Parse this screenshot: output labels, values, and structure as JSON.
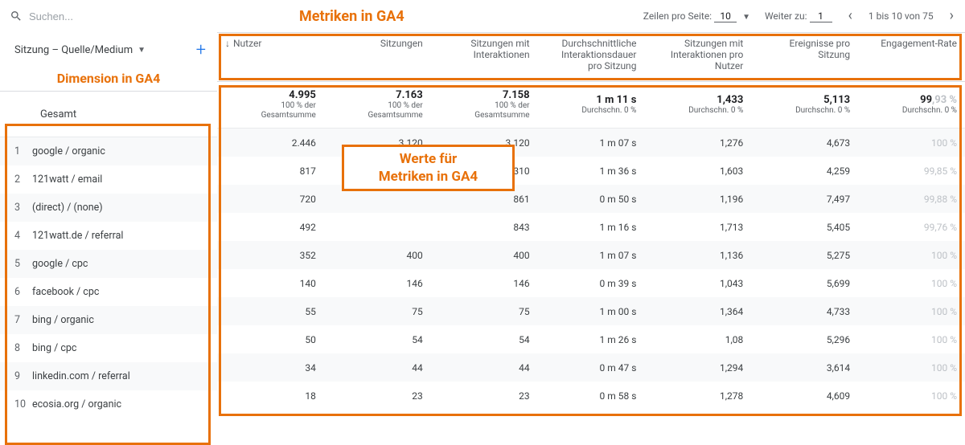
{
  "search": {
    "placeholder": "Suchen..."
  },
  "annotations": {
    "metrics_title": "Metriken in GA4",
    "dimension_title": "Dimension in GA4",
    "values_line1": "Werte für",
    "values_line2": "Metriken in GA4"
  },
  "pager": {
    "rows_per_page_label": "Zeilen pro Seite:",
    "rows_per_page_value": "10",
    "goto_label": "Weiter zu:",
    "goto_value": "1",
    "range_text": "1 bis 10 von 75"
  },
  "dimension": {
    "label": "Sitzung – Quelle/Medium"
  },
  "columns": [
    "Nutzer",
    "Sitzungen",
    "Sitzungen mit Interaktionen",
    "Durchschnittliche Interaktionsdauer pro Sitzung",
    "Sitzungen mit Interaktionen pro Nutzer",
    "Ereignisse pro Sitzung",
    "Engagement-Rate"
  ],
  "totals": {
    "label": "Gesamt",
    "cells": [
      {
        "big": "4.995",
        "sub": "100 % der Gesamtsumme"
      },
      {
        "big": "7.163",
        "sub": "100 % der Gesamtsumme"
      },
      {
        "big": "7.158",
        "sub": "100 % der Gesamtsumme"
      },
      {
        "big": "1 m 11 s",
        "sub": "Durchschn. 0 %"
      },
      {
        "big": "1,433",
        "sub": "Durchschn. 0 %"
      },
      {
        "big": "5,113",
        "sub": "Durchschn. 0 %"
      },
      {
        "big": "99,93 %",
        "sub": "Durchschn. 0 %",
        "faded": true
      }
    ]
  },
  "rows": [
    {
      "idx": "1",
      "dim": "google / organic",
      "v": [
        "2.446",
        "3.120",
        "3.120",
        "1 m 07 s",
        "1,276",
        "4,673",
        "100 %"
      ]
    },
    {
      "idx": "2",
      "dim": "121watt / email",
      "v": [
        "817",
        "",
        "1.310",
        "1 m 36 s",
        "1,603",
        "4,259",
        "99,85 %"
      ]
    },
    {
      "idx": "3",
      "dim": "(direct) / (none)",
      "v": [
        "720",
        "",
        "861",
        "0 m 50 s",
        "1,196",
        "7,497",
        "99,88 %"
      ]
    },
    {
      "idx": "4",
      "dim": "121watt.de / referral",
      "v": [
        "492",
        "",
        "843",
        "1 m 16 s",
        "1,713",
        "5,405",
        "99,76 %"
      ]
    },
    {
      "idx": "5",
      "dim": "google / cpc",
      "v": [
        "352",
        "400",
        "400",
        "1 m 07 s",
        "1,136",
        "5,275",
        "100 %"
      ]
    },
    {
      "idx": "6",
      "dim": "facebook / cpc",
      "v": [
        "140",
        "146",
        "146",
        "0 m 39 s",
        "1,043",
        "5,699",
        "100 %"
      ]
    },
    {
      "idx": "7",
      "dim": "bing / organic",
      "v": [
        "55",
        "75",
        "75",
        "1 m 00 s",
        "1,364",
        "4,733",
        "100 %"
      ]
    },
    {
      "idx": "8",
      "dim": "bing / cpc",
      "v": [
        "50",
        "54",
        "54",
        "1 m 26 s",
        "1,08",
        "5,296",
        "100 %"
      ]
    },
    {
      "idx": "9",
      "dim": "linkedin.com / referral",
      "v": [
        "34",
        "44",
        "44",
        "0 m 47 s",
        "1,294",
        "3,614",
        "100 %"
      ]
    },
    {
      "idx": "10",
      "dim": "ecosia.org / organic",
      "v": [
        "18",
        "23",
        "23",
        "0 m 58 s",
        "1,278",
        "4,609",
        "100 %"
      ]
    }
  ]
}
